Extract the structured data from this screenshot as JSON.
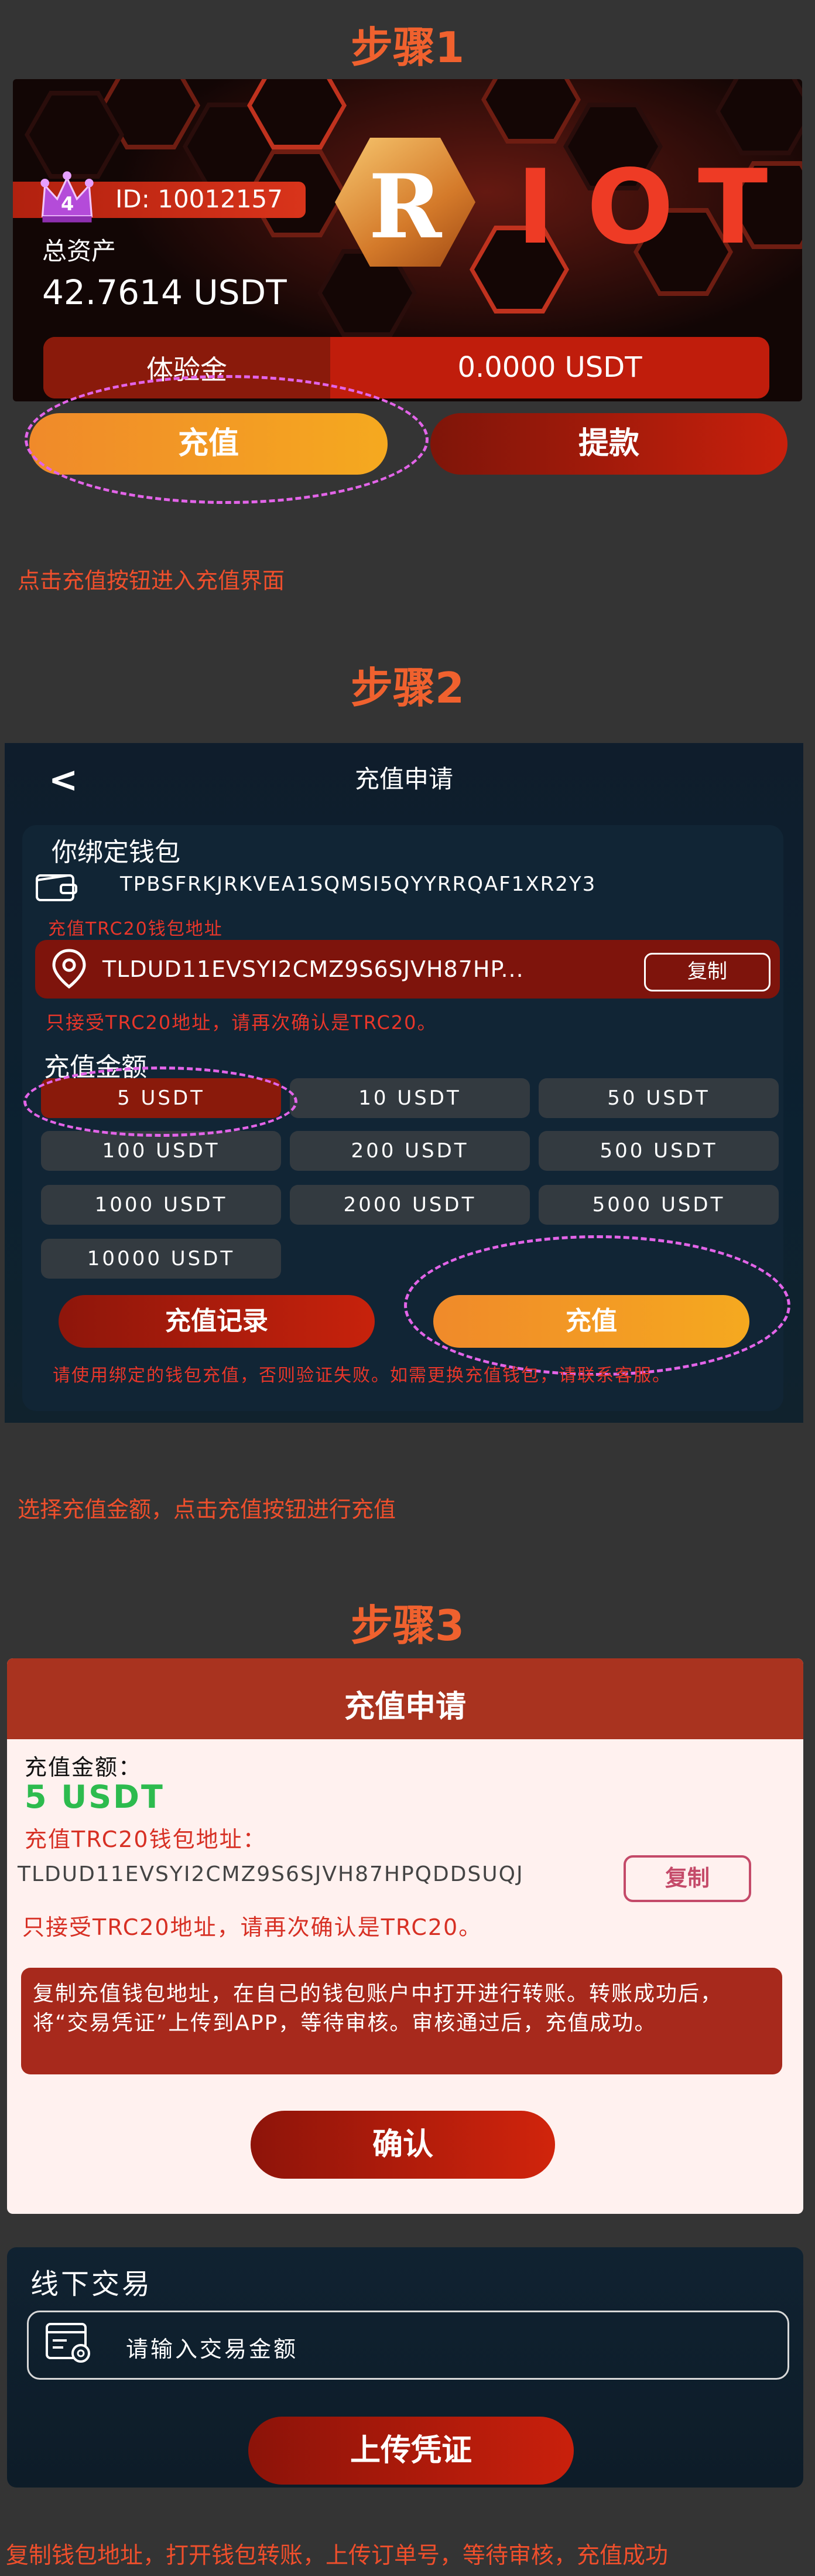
{
  "steps": {
    "step1_title": "步骤1",
    "step2_title": "步骤2",
    "step3_title": "步骤3"
  },
  "panel1": {
    "logo_text": "R",
    "brand_letters": [
      "I",
      "O",
      "T"
    ],
    "rank": "4",
    "id_label": "ID: 10012157",
    "total_assets_label": "总资产",
    "total_assets_value": "42.7614 USDT",
    "trial_label": "体验金",
    "trial_value": "0.0000 USDT",
    "recharge_button": "充值",
    "withdraw_button": "提款",
    "caption": "点击充值按钮进入充值界面"
  },
  "panel2": {
    "back_icon": "chevron-left-icon",
    "title": "充值申请",
    "wallet_section": "你绑定钱包",
    "bound_wallet": "TPBSFRKJRKVEA1SQMSI5QYYRRQAF1XR2Y3",
    "trc20_label": "充值TRC20钱包地址",
    "deposit_address": "TLDUD11EVSYI2CMZ9S6SJVH87HP...",
    "copy_button": "复制",
    "trc20_warning": "只接受TRC20地址，请再次确认是TRC20。",
    "amount_section": "充值金额",
    "amounts": [
      "5 USDT",
      "10 USDT",
      "50 USDT",
      "100 USDT",
      "200 USDT",
      "500 USDT",
      "1000 USDT",
      "2000 USDT",
      "5000 USDT",
      "10000 USDT"
    ],
    "selected_amount": "5 USDT",
    "records_button": "充值记录",
    "recharge_button": "充值",
    "note": "请使用绑定的钱包充值，否则验证失败。如需更换充值钱包，请联系客服。",
    "caption": "选择充值金额，点击充值按钮进行充值"
  },
  "panel3": {
    "title": "充值申请",
    "amount_label": "充值金额：",
    "amount_value": "5 USDT",
    "address_label": "充值TRC20钱包地址：",
    "address_value": "TLDUD11EVSYI2CMZ9S6SJVH87HPQDDSUQJ",
    "copy_button": "复制",
    "warning": "只接受TRC20地址，请再次确认是TRC20。",
    "instructions": "复制充值钱包地址，在自己的钱包账户中打开进行转账。转账成功后，将“交易凭证”上传到APP，等待审核。审核通过后，充值成功。",
    "confirm_button": "确认"
  },
  "panel4": {
    "title": "线下交易",
    "input_placeholder": "请输入交易金额",
    "upload_button": "上传凭证",
    "caption": "复制钱包地址，打开钱包转账，上传订单号，等待审核，充值成功"
  },
  "colors": {
    "accent_orange": "#f0612e",
    "caption_red": "#ef4f2c",
    "highlight_dash": "#e264e8",
    "success_green": "#2dbb4e"
  }
}
